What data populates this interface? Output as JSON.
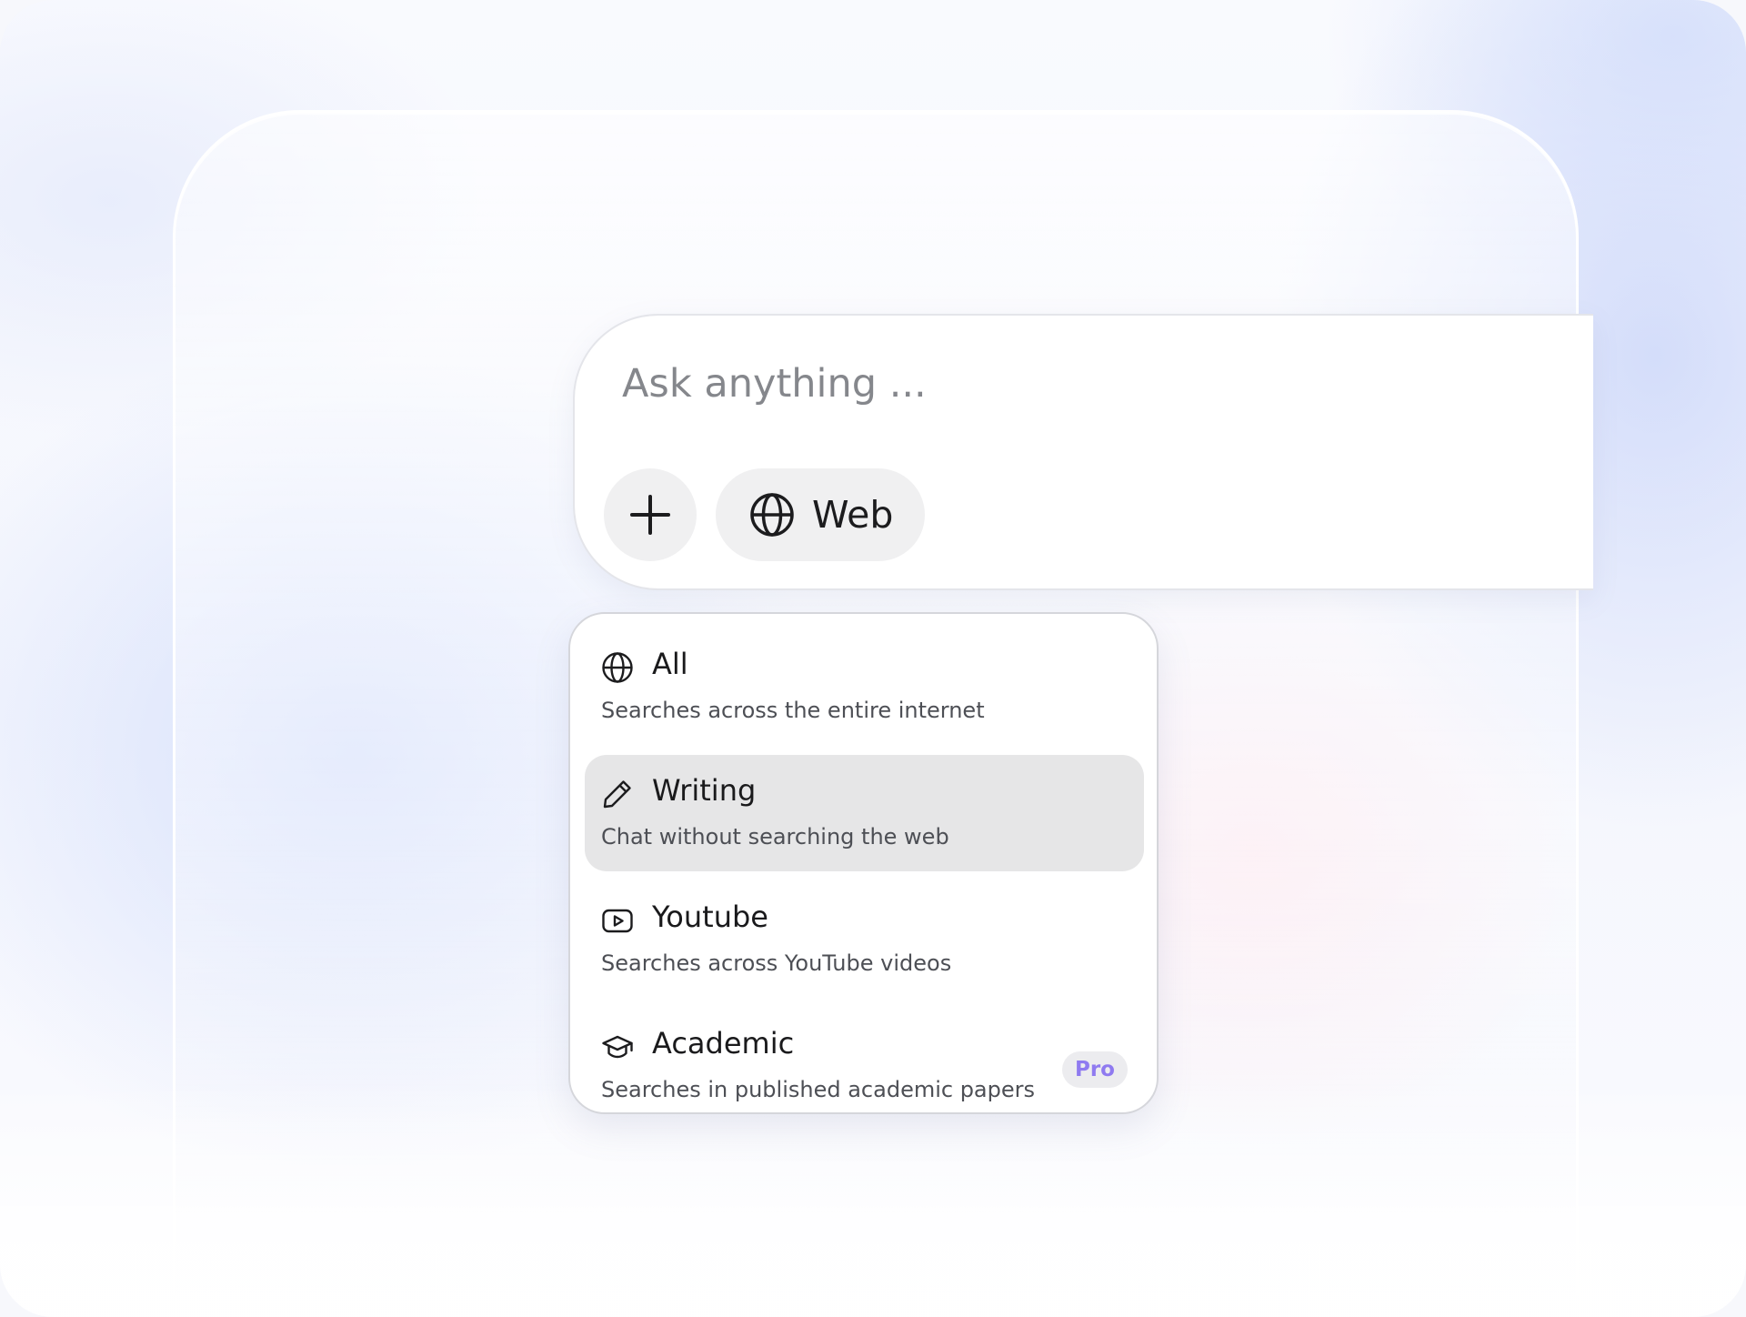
{
  "search": {
    "placeholder": "Ask anything ...",
    "value": ""
  },
  "toolbar": {
    "add_icon": "plus-icon",
    "mode_button": {
      "label": "Web",
      "icon": "globe-icon"
    }
  },
  "mode_menu": {
    "selected": "Writing",
    "items": [
      {
        "title": "All",
        "description": "Searches across the entire internet",
        "icon": "globe-icon"
      },
      {
        "title": "Writing",
        "description": "Chat without searching the web",
        "icon": "pencil-icon"
      },
      {
        "title": "Youtube",
        "description": "Searches across YouTube videos",
        "icon": "youtube-icon"
      },
      {
        "title": "Academic",
        "description": "Searches in published academic papers",
        "icon": "graduation-cap-icon",
        "badge": "Pro"
      }
    ]
  },
  "colors": {
    "selected_item_bg": "#e6e6e7",
    "pro_badge_text": "#8f7af0",
    "pro_badge_bg": "#ececef",
    "button_bg": "#f0f0f1"
  }
}
